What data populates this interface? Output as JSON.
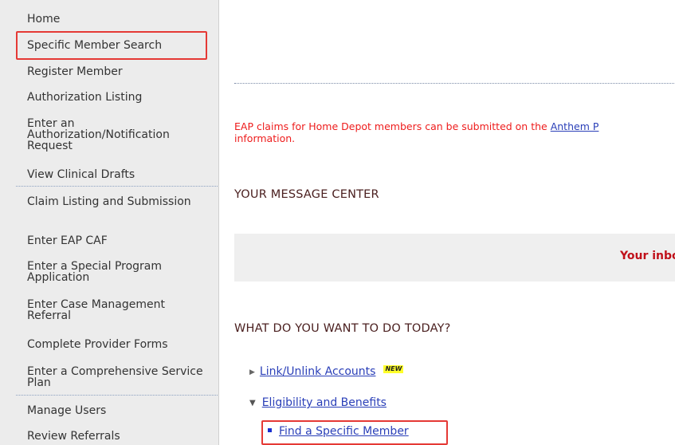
{
  "sidebar": {
    "items": [
      {
        "label": "Home"
      },
      {
        "label": "Specific Member Search"
      },
      {
        "label": "Register Member"
      },
      {
        "label": "Authorization Listing"
      },
      {
        "label": "Enter an Authorization/Notification Request"
      },
      {
        "label": "View Clinical Drafts"
      },
      {
        "label": "Claim Listing and Submission"
      },
      {
        "label": "Enter EAP CAF"
      },
      {
        "label": "Enter a Special Program Application"
      },
      {
        "label": "Enter Case Management Referral"
      },
      {
        "label": "Complete Provider Forms"
      },
      {
        "label": "Enter a Comprehensive Service Plan"
      },
      {
        "label": "Manage Users"
      },
      {
        "label": "Review Referrals"
      }
    ]
  },
  "notice": {
    "text_before": "EAP claims for Home Depot members can be submitted on the ",
    "link": "Anthem P",
    "text_after": "information."
  },
  "message_center": {
    "heading": "YOUR MESSAGE CENTER",
    "inbox_text": "Your inbox"
  },
  "todo": {
    "heading": "WHAT DO YOU WANT TO DO TODAY?",
    "items": [
      {
        "label": "Link/Unlink Accounts",
        "badge": "NEW"
      },
      {
        "label": "Eligibility and Benefits"
      },
      {
        "label": "Find a Specific Member"
      }
    ]
  },
  "colors": {
    "highlight": "#e53935",
    "notice": "#ee1c1c",
    "link": "#2a3fb8",
    "heading": "#4b2020"
  }
}
